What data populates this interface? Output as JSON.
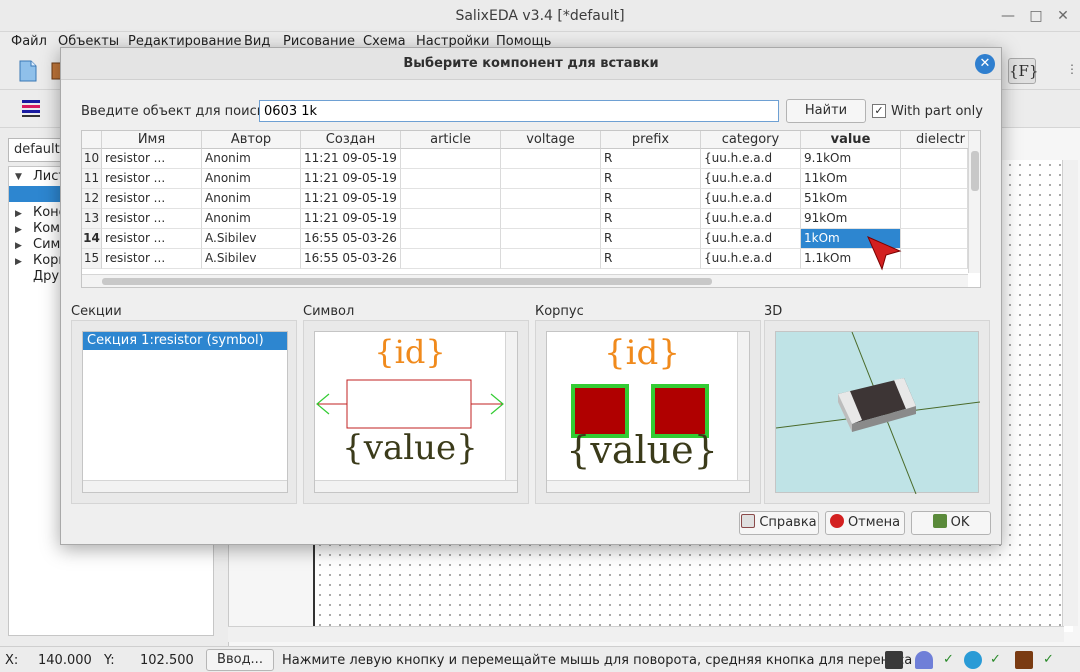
{
  "window": {
    "title": "SalixEDA v3.4 [*default]"
  },
  "menu": [
    "Файл",
    "Объекты",
    "Редактирование",
    "Вид",
    "Рисование",
    "Схема",
    "Настройки",
    "Помощь"
  ],
  "leftpanel": {
    "combo": "default",
    "tree": [
      "Лист",
      "Конс",
      "Комп",
      "Сим",
      "Корп",
      "Дру"
    ]
  },
  "dialog": {
    "title": "Выберите компонент для вставки",
    "search_label": "Введите объект для поиска:",
    "search_value": "0603 1k",
    "find_button": "Найти",
    "with_part_only": "With part only",
    "with_part_only_checked": true,
    "columns": [
      "Имя",
      "Автор",
      "Создан",
      "article",
      "voltage",
      "prefix",
      "category",
      "value",
      "dielectr"
    ],
    "rows": [
      {
        "n": "10",
        "name": "resistor ...",
        "author": "Anonim",
        "created": "11:21 09-05-19",
        "article": "",
        "voltage": "",
        "prefix": "R",
        "category": "{uu.h.e.a.d",
        "value": "9.1kOm"
      },
      {
        "n": "11",
        "name": "resistor ...",
        "author": "Anonim",
        "created": "11:21 09-05-19",
        "article": "",
        "voltage": "",
        "prefix": "R",
        "category": "{uu.h.e.a.d",
        "value": "11kOm"
      },
      {
        "n": "12",
        "name": "resistor ...",
        "author": "Anonim",
        "created": "11:21 09-05-19",
        "article": "",
        "voltage": "",
        "prefix": "R",
        "category": "{uu.h.e.a.d",
        "value": "51kOm"
      },
      {
        "n": "13",
        "name": "resistor ...",
        "author": "Anonim",
        "created": "11:21 09-05-19",
        "article": "",
        "voltage": "",
        "prefix": "R",
        "category": "{uu.h.e.a.d",
        "value": "91kOm"
      },
      {
        "n": "14",
        "name": "resistor ...",
        "author": "A.Sibilev",
        "created": "16:55 05-03-26",
        "article": "",
        "voltage": "",
        "prefix": "R",
        "category": "{uu.h.e.a.d",
        "value": "1kOm"
      },
      {
        "n": "15",
        "name": "resistor ...",
        "author": "A.Sibilev",
        "created": "16:55 05-03-26",
        "article": "",
        "voltage": "",
        "prefix": "R",
        "category": "{uu.h.e.a.d",
        "value": "1.1kOm"
      }
    ],
    "selected_row": "14",
    "sections_label": "Секции",
    "section_item": "Секция 1:resistor (symbol)",
    "symbol_label": "Символ",
    "package_label": "Корпус",
    "view3d_label": "3D",
    "symbol_id_text": "{id}",
    "symbol_value_text": "{value}",
    "help_button": "Справка",
    "cancel_button": "Отмена",
    "ok_button": "OK"
  },
  "status": {
    "x_label": "X:",
    "x_value": "140.000",
    "y_label": "Y:",
    "y_value": "102.500",
    "input_button": "Ввод...",
    "hint": "Нажмите левую кнопку и перемещайте мышь для поворота, средняя кнопка для переноса"
  },
  "colors": {
    "selection": "#2d86d0",
    "symbol_text": "#f08a1c",
    "value_text": "#3b3b1a",
    "pad": "#b00000",
    "pad_outline": "#33cc33",
    "bg3d": "#bfe3e6"
  },
  "icons": [
    "new-file-icon",
    "open-icon",
    "layers-icon",
    "function-icon",
    "dvr-icon",
    "scanner-icon",
    "cloud-icon",
    "book-icon"
  ]
}
